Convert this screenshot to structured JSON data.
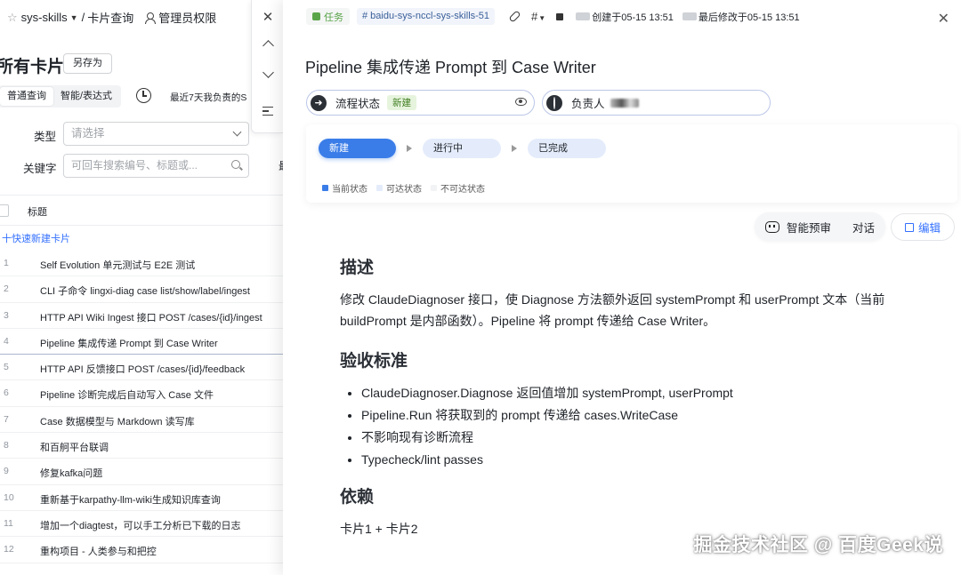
{
  "left": {
    "breadcrumb": {
      "space": "sys-skills",
      "page": "卡片查询",
      "permission": "管理员权限"
    },
    "view_title": "所有卡片",
    "save_as": "另存为",
    "modes": [
      "普通查询",
      "智能/表达式"
    ],
    "recent": "最近7天我负责的S",
    "filters": {
      "type_label": "类型",
      "type_placeholder": "请选择",
      "keyword_label": "关键字",
      "keyword_placeholder": "可回车搜索编号、标题或..."
    },
    "cut_label": "最",
    "table_header": "标题",
    "quick_add": "十快速新建卡片",
    "rows": [
      {
        "num": "1",
        "title": "Self Evolution 单元测试与 E2E 测试"
      },
      {
        "num": "2",
        "title": "CLI 子命令 lingxi-diag case list/show/label/ingest"
      },
      {
        "num": "3",
        "title": "HTTP API Wiki Ingest 接口 POST /cases/{id}/ingest"
      },
      {
        "num": "4",
        "title": "Pipeline 集成传递 Prompt 到 Case Writer"
      },
      {
        "num": "5",
        "title": "HTTP API 反馈接口 POST /cases/{id}/feedback"
      },
      {
        "num": "6",
        "title": "Pipeline 诊断完成后自动写入 Case 文件"
      },
      {
        "num": "7",
        "title": "Case 数据模型与 Markdown 读写库"
      },
      {
        "num": "8",
        "title": "和百舸平台联调"
      },
      {
        "num": "9",
        "title": "修复kafka问题"
      },
      {
        "num": "10",
        "title": "重新基于karpathy-llm-wiki生成知识库查询"
      },
      {
        "num": "11",
        "title": "增加一个diagtest，可以手工分析已下载的日志"
      },
      {
        "num": "12",
        "title": "重构项目 - 人类参与和把控"
      }
    ]
  },
  "detail": {
    "type_tag": "任务",
    "card_id": "# baidu-sys-nccl-sys-skills-51",
    "hash_label": "#",
    "created": "创建于05-15 13:51",
    "modified": "最后修改于05-15 13:51",
    "title": "Pipeline 集成传递 Prompt 到 Case Writer",
    "status_field": {
      "label": "流程状态",
      "value": "新建"
    },
    "owner_field": {
      "label": "负责人"
    },
    "states": [
      "新建",
      "进行中",
      "已完成"
    ],
    "legend": [
      "当前状态",
      "可达状态",
      "不可达状态"
    ],
    "ai_label": "智能预审",
    "chat_label": "对话",
    "edit_label": "编辑",
    "content": {
      "desc_heading": "描述",
      "desc_text": "修改 ClaudeDiagnoser 接口，使 Diagnose 方法额外返回 systemPrompt 和 userPrompt 文本（当前 buildPrompt 是内部函数）。Pipeline 将 prompt 传递给 Case Writer。",
      "accept_heading": "验收标准",
      "accept_items": [
        "ClaudeDiagnoser.Diagnose 返回值增加 systemPrompt, userPrompt",
        "Pipeline.Run 将获取到的 prompt 传递给 cases.WriteCase",
        "不影响现有诊断流程",
        "Typecheck/lint passes"
      ],
      "deps_heading": "依赖",
      "deps_text": "卡片1 + 卡片2"
    }
  },
  "watermark": "掘金技术社区 @ 百度Geek说",
  "colors": {
    "accent": "#3370ff",
    "state_current": "#3a7de8",
    "state_reachable": "#e4ecfb",
    "task_green": "#5aa54a"
  }
}
